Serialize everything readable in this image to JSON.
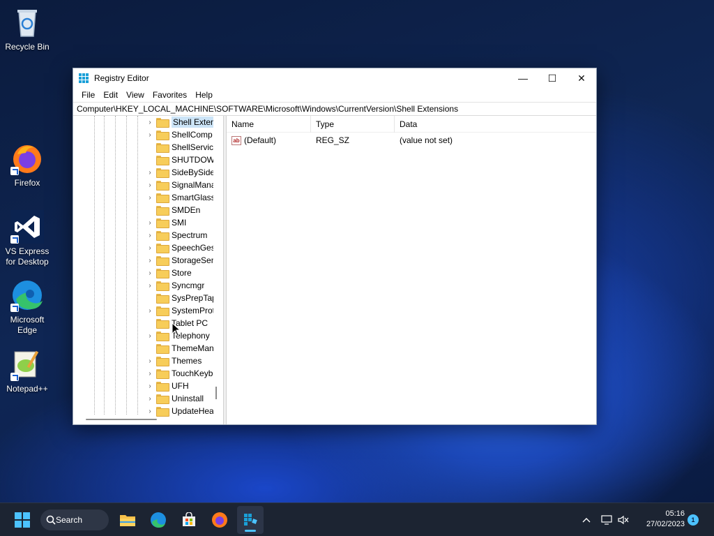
{
  "desktop": {
    "icons": [
      {
        "label": "Recycle Bin"
      },
      {
        "label": "Firefox"
      },
      {
        "label": "VS Express for Desktop"
      },
      {
        "label": "Microsoft Edge"
      },
      {
        "label": "Notepad++"
      }
    ]
  },
  "window": {
    "title": "Registry Editor",
    "minimize": "—",
    "maximize": "☐",
    "close": "✕"
  },
  "menu": [
    "File",
    "Edit",
    "View",
    "Favorites",
    "Help"
  ],
  "address": "Computer\\HKEY_LOCAL_MACHINE\\SOFTWARE\\Microsoft\\Windows\\CurrentVersion\\Shell Extensions",
  "tree": {
    "items": [
      {
        "label": "Shell Extens",
        "expandable": true,
        "selected": true
      },
      {
        "label": "ShellComp",
        "expandable": true
      },
      {
        "label": "ShellService",
        "expandable": false
      },
      {
        "label": "SHUTDOWI",
        "expandable": false
      },
      {
        "label": "SideBySide",
        "expandable": true
      },
      {
        "label": "SignalMana",
        "expandable": true
      },
      {
        "label": "SmartGlass",
        "expandable": true
      },
      {
        "label": "SMDEn",
        "expandable": false
      },
      {
        "label": "SMI",
        "expandable": true
      },
      {
        "label": "Spectrum",
        "expandable": true
      },
      {
        "label": "SpeechGest",
        "expandable": true
      },
      {
        "label": "StorageSen",
        "expandable": true
      },
      {
        "label": "Store",
        "expandable": true
      },
      {
        "label": "Syncmgr",
        "expandable": true
      },
      {
        "label": "SysPrepTap",
        "expandable": false
      },
      {
        "label": "SystemProt",
        "expandable": true
      },
      {
        "label": "Tablet PC",
        "expandable": false
      },
      {
        "label": "Telephony",
        "expandable": true
      },
      {
        "label": "ThemeMan",
        "expandable": false
      },
      {
        "label": "Themes",
        "expandable": true
      },
      {
        "label": "TouchKeyb",
        "expandable": true
      },
      {
        "label": "UFH",
        "expandable": true
      },
      {
        "label": "Uninstall",
        "expandable": true
      },
      {
        "label": "UpdateHea",
        "expandable": true
      }
    ]
  },
  "list": {
    "columns": {
      "name": "Name",
      "type": "Type",
      "data": "Data"
    },
    "rows": [
      {
        "name": "(Default)",
        "type": "REG_SZ",
        "data": "(value not set)"
      }
    ]
  },
  "taskbar": {
    "search_label": "Search",
    "time": "05:16",
    "date": "27/02/2023",
    "notification_count": "1"
  },
  "colors": {
    "accent": "#4cc2ff",
    "selection": "#cce4f7",
    "folder": "#f7cd5a"
  }
}
